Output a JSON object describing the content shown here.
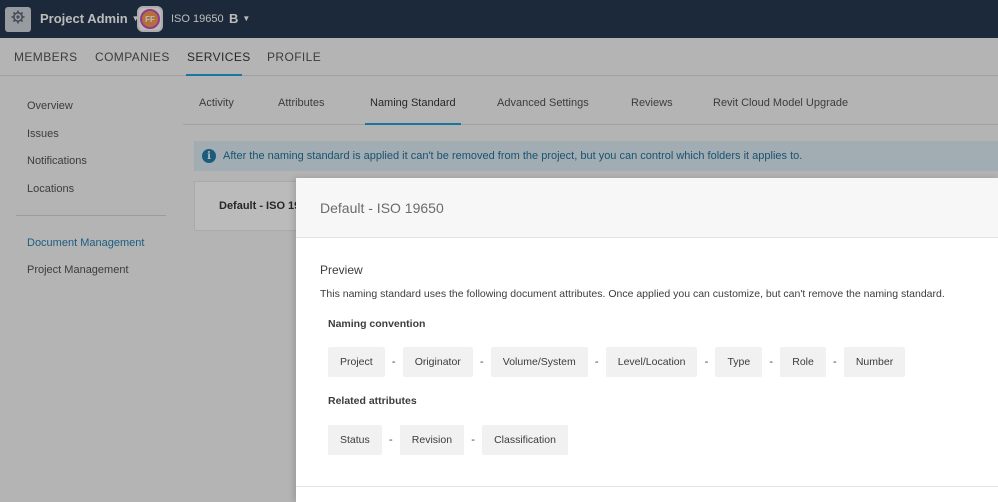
{
  "topbar": {
    "app_name": "Project Admin",
    "project_avatar_initials": "FF",
    "project_name": "ISO 19650",
    "project_badge": "B",
    "background_color": "#0b1f3a"
  },
  "main_nav": {
    "tabs": [
      {
        "label": "MEMBERS",
        "active": false
      },
      {
        "label": "COMPANIES",
        "active": false
      },
      {
        "label": "SERVICES",
        "active": true
      },
      {
        "label": "PROFILE",
        "active": false
      }
    ],
    "accent_color": "#0696d7"
  },
  "sidebar": {
    "items": [
      {
        "label": "Overview"
      },
      {
        "label": "Issues"
      },
      {
        "label": "Notifications"
      },
      {
        "label": "Locations"
      },
      {
        "label": "Document Management",
        "selected": true
      },
      {
        "label": "Project Management"
      }
    ]
  },
  "sub_tabs": [
    {
      "label": "Activity",
      "active": false
    },
    {
      "label": "Attributes",
      "active": false
    },
    {
      "label": "Naming Standard",
      "active": true
    },
    {
      "label": "Advanced Settings",
      "active": false
    },
    {
      "label": "Reviews",
      "active": false
    },
    {
      "label": "Revit Cloud Model Upgrade",
      "active": false
    }
  ],
  "banner": {
    "icon": "info-icon",
    "text": "After the naming standard is applied it can't be removed from the project, but you can control which folders it applies to."
  },
  "card": {
    "title": "Default - ISO 19"
  },
  "modal": {
    "title": "Default - ISO 19650",
    "preview_heading": "Preview",
    "preview_description": "This naming standard uses the following document attributes. Once applied you can customize, but can't remove the naming standard.",
    "naming_convention_label": "Naming convention",
    "naming_convention": [
      "Project",
      "Originator",
      "Volume/System",
      "Level/Location",
      "Type",
      "Role",
      "Number"
    ],
    "related_attributes_label": "Related attributes",
    "related_attributes": [
      "Status",
      "Revision",
      "Classification"
    ],
    "separator": "-"
  }
}
